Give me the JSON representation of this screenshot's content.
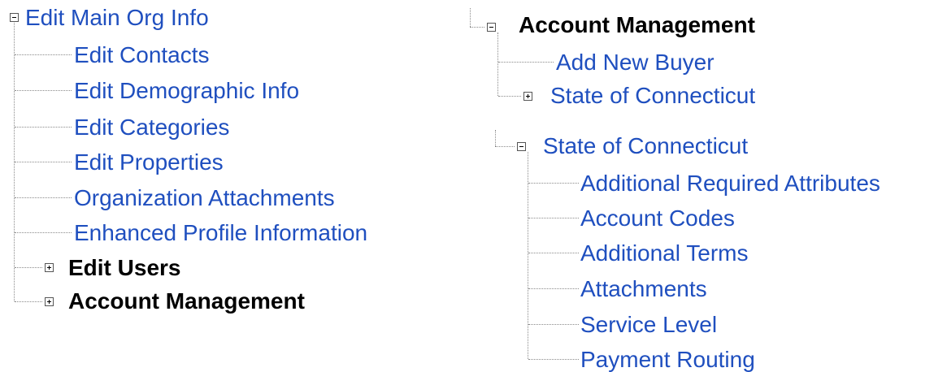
{
  "left_tree": {
    "root": {
      "label": "Edit Main Org Info",
      "expanded": true,
      "expander_icon": "minus-box-icon"
    },
    "children": [
      {
        "label": "Edit Contacts"
      },
      {
        "label": "Edit Demographic Info"
      },
      {
        "label": "Edit Categories"
      },
      {
        "label": "Edit Properties"
      },
      {
        "label": "Organization Attachments"
      },
      {
        "label": "Enhanced Profile Information"
      },
      {
        "label": "Edit Users",
        "expanded": false,
        "expander_icon": "plus-box-icon"
      },
      {
        "label": "Account Management",
        "expanded": false,
        "expander_icon": "plus-box-icon"
      }
    ]
  },
  "right_tree_1": {
    "root": {
      "label": "Account Management",
      "expanded": true,
      "expander_icon": "minus-box-icon"
    },
    "children": [
      {
        "label": "Add New Buyer"
      },
      {
        "label": "State of Connecticut",
        "expanded": false,
        "expander_icon": "plus-box-icon"
      }
    ]
  },
  "right_tree_2": {
    "root": {
      "label": "State of Connecticut",
      "expanded": true,
      "expander_icon": "minus-box-icon"
    },
    "children": [
      {
        "label": "Additional Required Attributes"
      },
      {
        "label": "Account Codes"
      },
      {
        "label": "Additional Terms"
      },
      {
        "label": "Attachments"
      },
      {
        "label": "Service Level"
      },
      {
        "label": "Payment Routing"
      }
    ]
  },
  "colors": {
    "link": "#1f4fbf",
    "bold_text": "#000000",
    "connector": "#8a8a8a"
  }
}
